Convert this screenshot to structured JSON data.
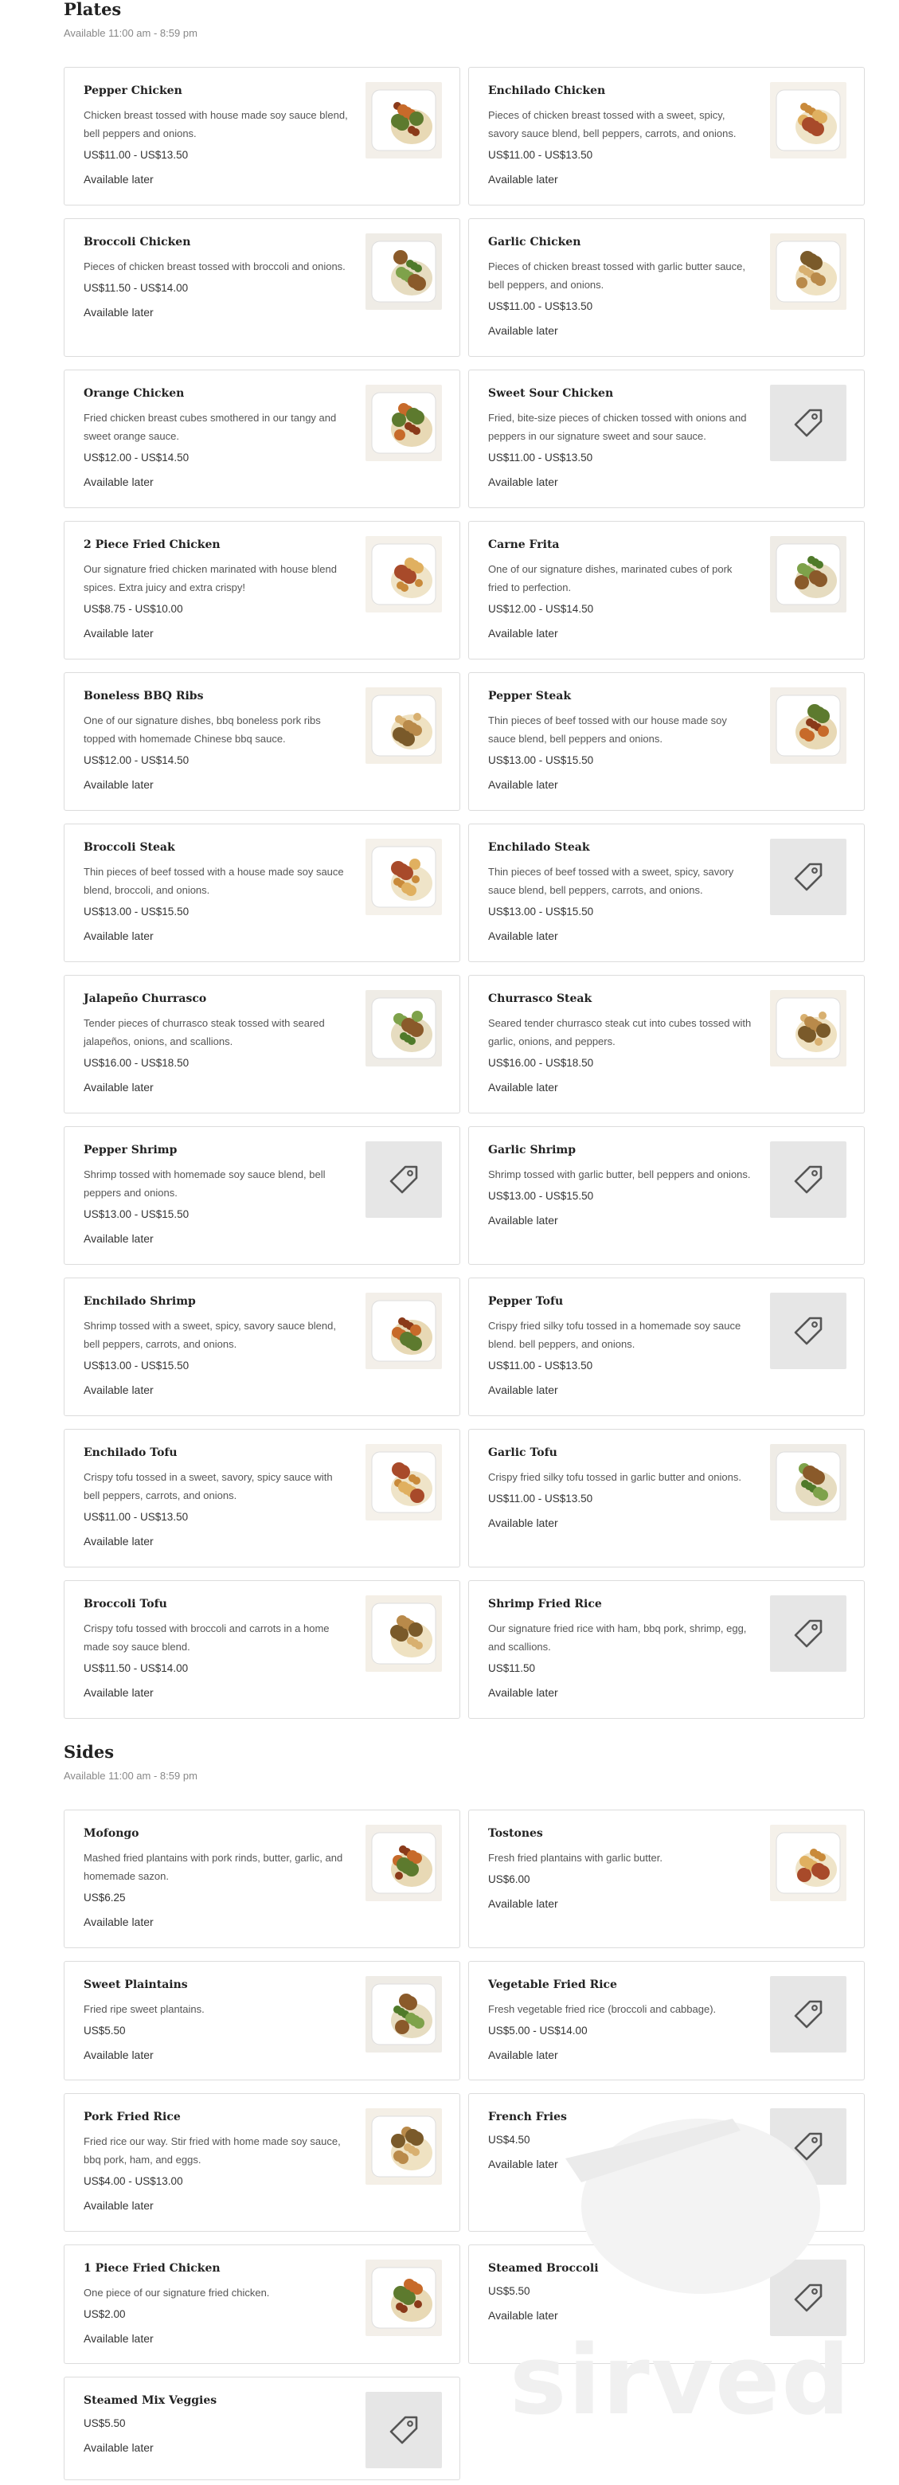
{
  "sections": [
    {
      "title": "Plates",
      "subtitle": "Available 11:00 am - 8:59 pm",
      "items": [
        {
          "name": "Pepper Chicken",
          "desc": "Chicken breast tossed with house made soy sauce blend, bell peppers and onions.",
          "price": "US$11.00 - US$13.50",
          "avail": "Available later",
          "image": "food-photo"
        },
        {
          "name": "Enchilado Chicken",
          "desc": "Pieces of chicken breast tossed with a sweet, spicy, savory sauce blend, bell peppers, carrots, and onions.",
          "price": "US$11.00 - US$13.50",
          "avail": "Available later",
          "image": "food-photo"
        },
        {
          "name": "Broccoli Chicken",
          "desc": "Pieces of chicken breast tossed with broccoli and onions.",
          "price": "US$11.50 - US$14.00",
          "avail": "Available later",
          "image": "food-photo"
        },
        {
          "name": "Garlic Chicken",
          "desc": "Pieces of chicken breast tossed with garlic butter sauce, bell peppers, and onions.",
          "price": "US$11.00 - US$13.50",
          "avail": "Available later",
          "image": "food-photo"
        },
        {
          "name": "Orange Chicken",
          "desc": "Fried chicken breast cubes smothered in our tangy and sweet orange sauce.",
          "price": "US$12.00 - US$14.50",
          "avail": "Available later",
          "image": "food-photo"
        },
        {
          "name": "Sweet Sour Chicken",
          "desc": "Fried, bite-size pieces of chicken tossed with onions and peppers in our signature sweet and sour sauce.",
          "price": "US$11.00 - US$13.50",
          "avail": "Available later",
          "image": "tag-icon"
        },
        {
          "name": "2 Piece Fried Chicken",
          "desc": "Our signature fried chicken marinated with house blend spices. Extra juicy and extra crispy!",
          "price": "US$8.75 - US$10.00",
          "avail": "Available later",
          "image": "food-photo"
        },
        {
          "name": "Carne Frita",
          "desc": "One of our signature dishes, marinated cubes of pork fried to perfection.",
          "price": "US$12.00 - US$14.50",
          "avail": "Available later",
          "image": "food-photo"
        },
        {
          "name": "Boneless BBQ Ribs",
          "desc": "One of our signature dishes, bbq boneless pork ribs topped with homemade Chinese bbq sauce.",
          "price": "US$12.00 - US$14.50",
          "avail": "Available later",
          "image": "food-photo"
        },
        {
          "name": "Pepper Steak",
          "desc": "Thin pieces of beef tossed with our house made soy sauce blend, bell peppers and onions.",
          "price": "US$13.00 - US$15.50",
          "avail": "Available later",
          "image": "food-photo"
        },
        {
          "name": "Broccoli Steak",
          "desc": "Thin pieces of beef tossed with a house made soy sauce blend, broccoli, and onions.",
          "price": "US$13.00 - US$15.50",
          "avail": "Available later",
          "image": "food-photo"
        },
        {
          "name": "Enchilado Steak",
          "desc": "Thin pieces of beef tossed with a sweet, spicy, savory sauce blend, bell peppers, carrots, and onions.",
          "price": "US$13.00 - US$15.50",
          "avail": "Available later",
          "image": "tag-icon"
        },
        {
          "name": "Jalapeño Churrasco",
          "desc": "Tender pieces of churrasco steak tossed with seared jalapeños, onions, and scallions.",
          "price": "US$16.00 - US$18.50",
          "avail": "Available later",
          "image": "food-photo"
        },
        {
          "name": "Churrasco Steak",
          "desc": "Seared tender churrasco steak cut into cubes tossed with garlic, onions, and peppers.",
          "price": "US$16.00 - US$18.50",
          "avail": "Available later",
          "image": "food-photo"
        },
        {
          "name": "Pepper Shrimp",
          "desc": "Shrimp tossed with homemade soy sauce blend, bell peppers and onions.",
          "price": "US$13.00 - US$15.50",
          "avail": "Available later",
          "image": "tag-icon"
        },
        {
          "name": "Garlic Shrimp",
          "desc": "Shrimp tossed with garlic butter, bell peppers and onions.",
          "price": "US$13.00 - US$15.50",
          "avail": "Available later",
          "image": "tag-icon"
        },
        {
          "name": "Enchilado Shrimp",
          "desc": "Shrimp tossed with a sweet, spicy, savory sauce blend, bell peppers, carrots, and onions.",
          "price": "US$13.00 - US$15.50",
          "avail": "Available later",
          "image": "food-photo"
        },
        {
          "name": "Pepper Tofu",
          "desc": "Crispy fried silky tofu tossed in a homemade soy sauce blend. bell peppers, and onions.",
          "price": "US$11.00 - US$13.50",
          "avail": "Available later",
          "image": "tag-icon"
        },
        {
          "name": "Enchilado Tofu",
          "desc": "Crispy tofu tossed in a sweet, savory, spicy sauce with bell peppers, carrots, and onions.",
          "price": "US$11.00 - US$13.50",
          "avail": "Available later",
          "image": "food-photo"
        },
        {
          "name": "Garlic Tofu",
          "desc": "Crispy fried silky tofu tossed in garlic butter and onions.",
          "price": "US$11.00 - US$13.50",
          "avail": "Available later",
          "image": "food-photo"
        },
        {
          "name": "Broccoli Tofu",
          "desc": "Crispy tofu tossed with broccoli and carrots in a home made soy sauce blend.",
          "price": "US$11.50 - US$14.00",
          "avail": "Available later",
          "image": "food-photo"
        },
        {
          "name": "Shrimp Fried Rice",
          "desc": "Our signature fried rice with ham, bbq pork, shrimp, egg, and scallions.",
          "price": "US$11.50",
          "avail": "Available later",
          "image": "tag-icon"
        }
      ]
    },
    {
      "title": "Sides",
      "subtitle": "Available 11:00 am - 8:59 pm",
      "items": [
        {
          "name": "Mofongo",
          "desc": "Mashed fried plantains with pork rinds, butter, garlic, and homemade sazon.",
          "price": "US$6.25",
          "avail": "Available later",
          "image": "food-photo"
        },
        {
          "name": "Tostones",
          "desc": "Fresh fried plantains with garlic butter.",
          "price": "US$6.00",
          "avail": "Available later",
          "image": "food-photo"
        },
        {
          "name": "Sweet Plaintains",
          "desc": "Fried ripe sweet plantains.",
          "price": "US$5.50",
          "avail": "Available later",
          "image": "food-photo"
        },
        {
          "name": "Vegetable Fried Rice",
          "desc": "Fresh vegetable fried rice (broccoli and cabbage).",
          "price": "US$5.00 - US$14.00",
          "avail": "Available later",
          "image": "tag-icon"
        },
        {
          "name": "Pork Fried Rice",
          "desc": "Fried rice our way. Stir fried with home made soy sauce, bbq pork, ham, and eggs.",
          "price": "US$4.00 - US$13.00",
          "avail": "Available later",
          "image": "food-photo"
        },
        {
          "name": "French Fries",
          "desc": "",
          "price": "US$4.50",
          "avail": "Available later",
          "image": "tag-icon"
        },
        {
          "name": "1 Piece Fried Chicken",
          "desc": "One piece of our signature fried chicken.",
          "price": "US$2.00",
          "avail": "Available later",
          "image": "food-photo"
        },
        {
          "name": "Steamed Broccoli",
          "desc": "",
          "price": "US$5.50",
          "avail": "Available later",
          "image": "tag-icon"
        },
        {
          "name": "Steamed Mix Veggies",
          "desc": "",
          "price": "US$5.50",
          "avail": "Available later",
          "image": "tag-icon"
        }
      ]
    }
  ],
  "watermark": {
    "text": "sirved"
  },
  "colors": {
    "border": "#dcdcdc",
    "placeholder_bg": "#e6e6e6",
    "text": "#333333",
    "muted": "#888888"
  }
}
